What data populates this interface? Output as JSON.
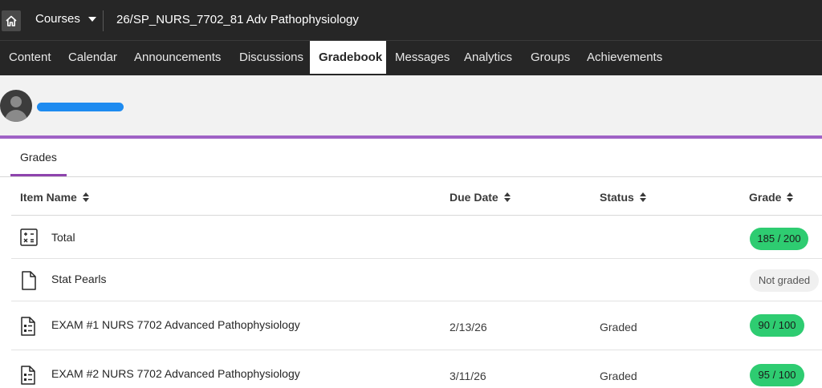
{
  "topbar": {
    "home_icon": "home-icon",
    "courses_label": "Courses",
    "course_title": "26/SP_NURS_7702_81 Adv Pathophysiology"
  },
  "nav": {
    "tabs": [
      {
        "label": "Content"
      },
      {
        "label": "Calendar"
      },
      {
        "label": "Announcements"
      },
      {
        "label": "Discussions"
      },
      {
        "label": "Gradebook",
        "active": true
      },
      {
        "label": "Messages"
      },
      {
        "label": "Analytics"
      },
      {
        "label": "Groups"
      },
      {
        "label": "Achievements"
      }
    ]
  },
  "profile": {
    "avatar_icon": "user-avatar-icon",
    "name_redacted": true
  },
  "subtabs": [
    {
      "label": "Grades",
      "active": true
    }
  ],
  "table": {
    "columns": [
      "Item Name",
      "Due Date",
      "Status",
      "Grade"
    ],
    "rows": [
      {
        "icon": "calculator-icon",
        "name": "Total",
        "due": "",
        "status": "",
        "grade": "185 / 200",
        "grade_style": "green"
      },
      {
        "icon": "document-icon",
        "name": "Stat Pearls",
        "due": "",
        "status": "",
        "grade": "Not graded",
        "grade_style": "grey"
      },
      {
        "icon": "test-icon",
        "name": "EXAM #1 NURS 7702 Advanced Pathophysiology",
        "due": "2/13/26",
        "status": "Graded",
        "grade": "90 / 100",
        "grade_style": "green"
      },
      {
        "icon": "test-icon",
        "name": "EXAM #2 NURS 7702 Advanced Pathophysiology",
        "due": "3/11/26",
        "status": "Graded",
        "grade": "95 / 100",
        "grade_style": "green"
      }
    ]
  },
  "colors": {
    "topbar_bg": "#262626",
    "accent_purple": "#a062c6",
    "grade_green": "#2ecc71",
    "redaction_blue": "#1e8bf0"
  }
}
